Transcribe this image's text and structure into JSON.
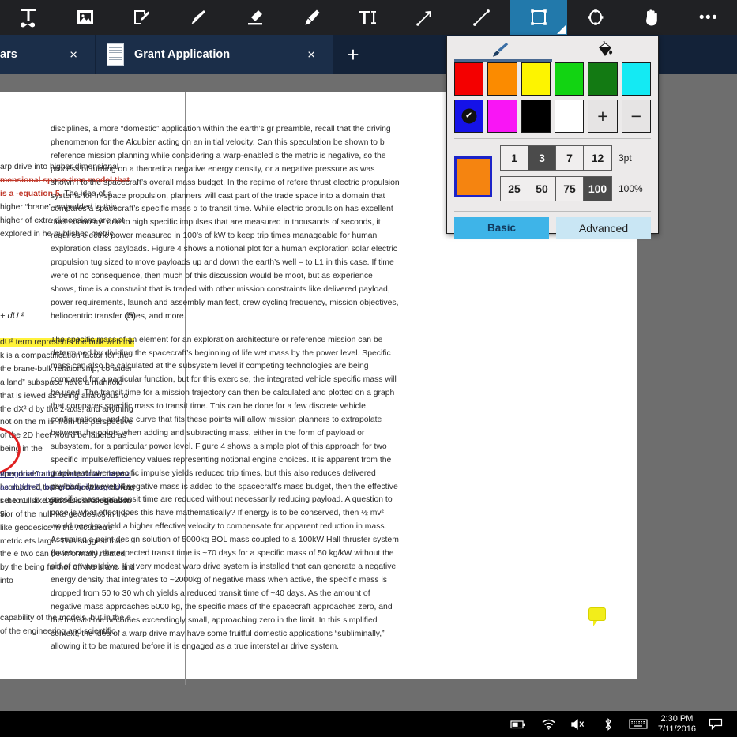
{
  "toolbar": {
    "tools": [
      {
        "name": "text-tool",
        "label": "Text"
      },
      {
        "name": "image-tool",
        "label": "Image"
      },
      {
        "name": "note-tool",
        "label": "Note"
      },
      {
        "name": "brush-tool",
        "label": "Brush"
      },
      {
        "name": "eraser-tool",
        "label": "Eraser"
      },
      {
        "name": "highlighter-tool",
        "label": "Highlighter"
      },
      {
        "name": "typewriter-tool",
        "label": "Typewriter"
      },
      {
        "name": "arrow-tool",
        "label": "Arrow"
      },
      {
        "name": "line-tool",
        "label": "Line"
      },
      {
        "name": "rectangle-tool",
        "label": "Rectangle"
      },
      {
        "name": "ellipse-tool",
        "label": "Ellipse"
      },
      {
        "name": "hand-tool",
        "label": "Pan"
      },
      {
        "name": "more-tool",
        "label": "More"
      }
    ],
    "selected": "rectangle-tool",
    "more_glyph": "•••"
  },
  "tabs": {
    "items": [
      {
        "label": "ars",
        "close": "×",
        "truncated": true
      },
      {
        "label": "Grant Application",
        "close": "×",
        "truncated": false
      }
    ],
    "new_tab_glyph": "+",
    "active_index": 1
  },
  "picker": {
    "modes": [
      {
        "name": "stroke-mode",
        "icon": "brush-icon",
        "active": true
      },
      {
        "name": "fill-mode",
        "icon": "paint-bucket-icon",
        "active": false
      }
    ],
    "swatches": [
      {
        "name": "red",
        "hex": "#f40000",
        "selected": false
      },
      {
        "name": "orange",
        "hex": "#fb8b00",
        "selected": false
      },
      {
        "name": "yellow",
        "hex": "#fdf400",
        "selected": false
      },
      {
        "name": "green",
        "hex": "#12d412",
        "selected": false
      },
      {
        "name": "dark-green",
        "hex": "#137a13",
        "selected": false
      },
      {
        "name": "cyan",
        "hex": "#14eaf3",
        "selected": false
      },
      {
        "name": "blue",
        "hex": "#1512e8",
        "selected": true
      },
      {
        "name": "magenta",
        "hex": "#f915f5",
        "selected": false
      },
      {
        "name": "black",
        "hex": "#000000",
        "selected": false
      },
      {
        "name": "white",
        "hex": "#ffffff",
        "selected": false
      }
    ],
    "add_label": "+",
    "remove_label": "−",
    "selected_check": "✔",
    "current_color": "#f58410",
    "current_color_border": "#1c23c8",
    "thickness": {
      "options": [
        "1",
        "3",
        "7",
        "12"
      ],
      "selected": "3",
      "caption": "3pt"
    },
    "opacity": {
      "options": [
        "25",
        "50",
        "75",
        "100"
      ],
      "selected": "100",
      "caption": "100%"
    },
    "basic_label": "Basic",
    "advanced_label": "Advanced",
    "active_button": "Basic"
  },
  "document": {
    "left_page": {
      "para1_a": "arp drive into higher dimensional ",
      "para1_strike": "mensional space-time model that is a -equation 5.",
      "para1_b": " The idea of a higher “brane” embedded in this higher of extra dimensions are not explored in he published metric.",
      "equation": "+ dU ²",
      "equation_number": "(5)",
      "para2_hl": "dU² term represents the bulk with the",
      "para2_rest": "k is a compactification factor for the the brane-bulk relationship, consider a land” subspace have a manifold that is iewed as being analogous to the dX² d by the z-axis, and anything not on the m is, from the perspective of the 2D heet would be labeled as being in the",
      "para3": "yper drive” and a warp drive, the null- l compared to the conjectured driving r the null-like geodesics for equation 5",
      "para4_ul": "rthogonal to the brane would have a as dU/dt=0, but arbitrarily large U",
      "para4_rest": "as set to 1, so dX/dt >1 is analogous to vior of the null-like geodesics in the -like geodesics in the Alcubierre metric ets large. This suggest that the e two can be informally related by the being further off the brane and into",
      "para5": "capability of the models, but in the e of the engineering and scientific"
    },
    "right_page": {
      "para1": "disciplines, a more “domestic” application within the earth’s gr preamble, recall that the driving phenomenon for the Alcubier acting on an initial velocity. Can this speculation be shown to b reference mission planning while considering a warp-enabled s the metric is negative, so the process of turning on a theoretica negative energy density, or a negative pressure as was shown i to the spacecraft’s overall mass budget. In the regime of refere thrust electric propulsion systems for in-space propulsion, planners will cast part of the trade space into a domain that compares a spacecraft’s specific mass α to transit time. While electric propulsion has excellent “fuel economy” due to high specific impulses that are measured in thousands of seconds, it requires electric power measured in 100’s of kW to keep trip times manageable for human exploration class payloads. Figure 4 shows a notional plot for a human exploration solar electric propulsion tug sized to move payloads up and down the earth’s well – to L1 in this case. If time were of no consequence, then much of this discussion would be moot, but as experience shows, time is a constraint that is traded with other mission constraints like delivered payload, power requirements, launch and assembly manifest, crew cycling frequency, mission objectives, heliocentric transfer dates, and more.",
      "para2": "The specific mass of an element for an exploration architecture or reference mission can be determined by dividing the spacecraft’s beginning of life wet mass by the power level. Specific mass can also be calculated at the subsystem level if competing technologies are being compared for a particular function, but for this exercise, the integrated vehicle specific mass will be used. The transit time for a mission trajectory can then be calculated and plotted on a graph that compares specific mass to transit time. This can be done for a few discrete vehicle configurations, and the curve that fits these points will allow mission planners to extrapolate between the points when adding and subtracting mass, either in the form of payload or subsystem, for a particular power level. Figure 4 shows a simple plot of this approach for two specific impulse/efficiency values representing notional engine choices. It is apparent from the graph that lower specific impulse yields reduced trip times, but this also reduces delivered payload. However, if negative mass is added to the spacecraft’s mass budget, then the effective specific mass and transit time are reduced without necessarily reducing payload. A question to pose is what effect does this have mathematically? If energy is to be conserved, then ½ mv² would need to yield a higher effective velocity to compensate for apparent reduction in mass. Assuming a point design solution of 5000kg BOL mass coupled to a 100kW Hall thruster system (lower curve), the expected transit time is ~70 days for a specific mass of 50 kg/kW without the aid of a warp drive. If a very modest warp drive system is installed that can generate a negative energy density that integrates to ~2000kg of negative mass when active, the specific mass is dropped from 50 to 30 which yields a reduced transit time of ~40 days. As the amount of negative mass approaches 5000 kg, the specific mass of the spacecraft approaches zero, and the transit time becomes exceedingly small, approaching zero in the limit. In this simplified context, the idea of a warp drive may have some fruitful domestic applications “subliminally,” allowing it to be matured before it is engaged as a true interstellar drive system."
    },
    "annotations": {
      "sticky_note": "comment-marker"
    }
  },
  "taskbar": {
    "tray": [
      {
        "name": "battery-icon"
      },
      {
        "name": "wifi-icon"
      },
      {
        "name": "volume-muted-icon"
      },
      {
        "name": "bluetooth-icon"
      },
      {
        "name": "keyboard-icon"
      }
    ],
    "time": "2:30 PM",
    "date": "7/11/2016",
    "action_center_icon": "notification-icon"
  }
}
